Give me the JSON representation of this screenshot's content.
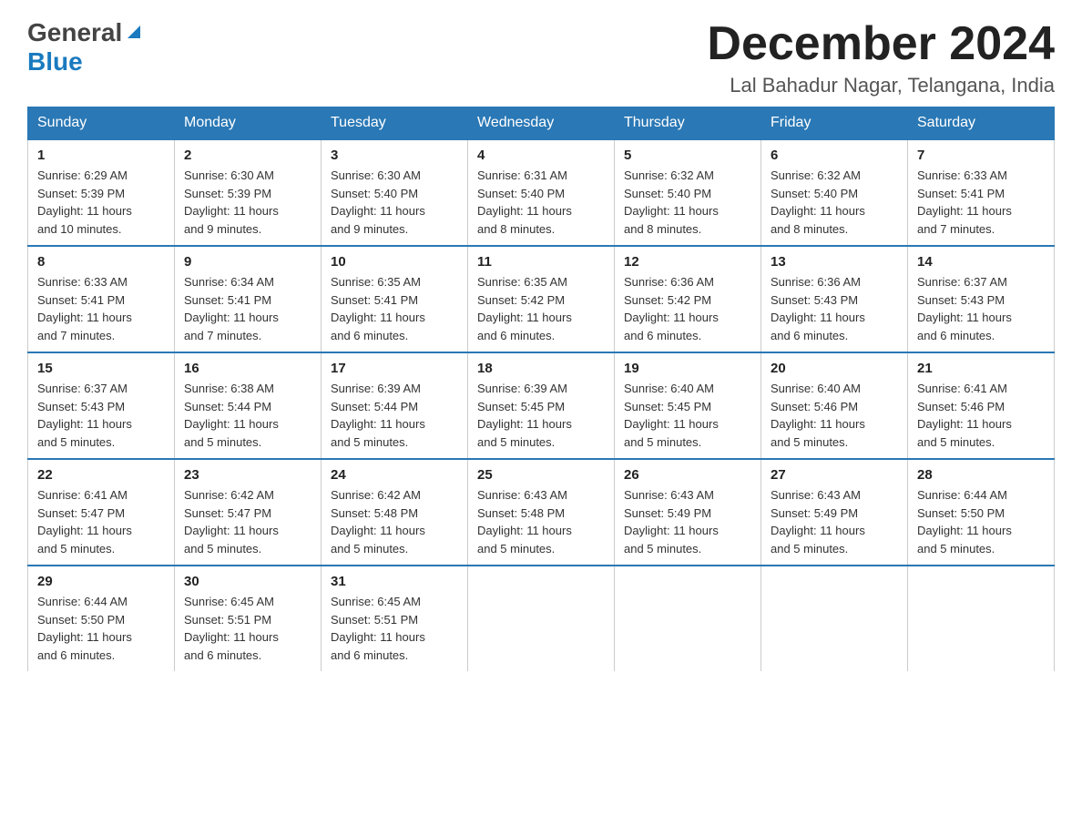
{
  "header": {
    "logo_general": "General",
    "logo_blue": "Blue",
    "month_title": "December 2024",
    "location": "Lal Bahadur Nagar, Telangana, India"
  },
  "days_of_week": [
    "Sunday",
    "Monday",
    "Tuesday",
    "Wednesday",
    "Thursday",
    "Friday",
    "Saturday"
  ],
  "weeks": [
    [
      {
        "day": "1",
        "sunrise": "6:29 AM",
        "sunset": "5:39 PM",
        "daylight": "11 hours and 10 minutes."
      },
      {
        "day": "2",
        "sunrise": "6:30 AM",
        "sunset": "5:39 PM",
        "daylight": "11 hours and 9 minutes."
      },
      {
        "day": "3",
        "sunrise": "6:30 AM",
        "sunset": "5:40 PM",
        "daylight": "11 hours and 9 minutes."
      },
      {
        "day": "4",
        "sunrise": "6:31 AM",
        "sunset": "5:40 PM",
        "daylight": "11 hours and 8 minutes."
      },
      {
        "day": "5",
        "sunrise": "6:32 AM",
        "sunset": "5:40 PM",
        "daylight": "11 hours and 8 minutes."
      },
      {
        "day": "6",
        "sunrise": "6:32 AM",
        "sunset": "5:40 PM",
        "daylight": "11 hours and 8 minutes."
      },
      {
        "day": "7",
        "sunrise": "6:33 AM",
        "sunset": "5:41 PM",
        "daylight": "11 hours and 7 minutes."
      }
    ],
    [
      {
        "day": "8",
        "sunrise": "6:33 AM",
        "sunset": "5:41 PM",
        "daylight": "11 hours and 7 minutes."
      },
      {
        "day": "9",
        "sunrise": "6:34 AM",
        "sunset": "5:41 PM",
        "daylight": "11 hours and 7 minutes."
      },
      {
        "day": "10",
        "sunrise": "6:35 AM",
        "sunset": "5:41 PM",
        "daylight": "11 hours and 6 minutes."
      },
      {
        "day": "11",
        "sunrise": "6:35 AM",
        "sunset": "5:42 PM",
        "daylight": "11 hours and 6 minutes."
      },
      {
        "day": "12",
        "sunrise": "6:36 AM",
        "sunset": "5:42 PM",
        "daylight": "11 hours and 6 minutes."
      },
      {
        "day": "13",
        "sunrise": "6:36 AM",
        "sunset": "5:43 PM",
        "daylight": "11 hours and 6 minutes."
      },
      {
        "day": "14",
        "sunrise": "6:37 AM",
        "sunset": "5:43 PM",
        "daylight": "11 hours and 6 minutes."
      }
    ],
    [
      {
        "day": "15",
        "sunrise": "6:37 AM",
        "sunset": "5:43 PM",
        "daylight": "11 hours and 5 minutes."
      },
      {
        "day": "16",
        "sunrise": "6:38 AM",
        "sunset": "5:44 PM",
        "daylight": "11 hours and 5 minutes."
      },
      {
        "day": "17",
        "sunrise": "6:39 AM",
        "sunset": "5:44 PM",
        "daylight": "11 hours and 5 minutes."
      },
      {
        "day": "18",
        "sunrise": "6:39 AM",
        "sunset": "5:45 PM",
        "daylight": "11 hours and 5 minutes."
      },
      {
        "day": "19",
        "sunrise": "6:40 AM",
        "sunset": "5:45 PM",
        "daylight": "11 hours and 5 minutes."
      },
      {
        "day": "20",
        "sunrise": "6:40 AM",
        "sunset": "5:46 PM",
        "daylight": "11 hours and 5 minutes."
      },
      {
        "day": "21",
        "sunrise": "6:41 AM",
        "sunset": "5:46 PM",
        "daylight": "11 hours and 5 minutes."
      }
    ],
    [
      {
        "day": "22",
        "sunrise": "6:41 AM",
        "sunset": "5:47 PM",
        "daylight": "11 hours and 5 minutes."
      },
      {
        "day": "23",
        "sunrise": "6:42 AM",
        "sunset": "5:47 PM",
        "daylight": "11 hours and 5 minutes."
      },
      {
        "day": "24",
        "sunrise": "6:42 AM",
        "sunset": "5:48 PM",
        "daylight": "11 hours and 5 minutes."
      },
      {
        "day": "25",
        "sunrise": "6:43 AM",
        "sunset": "5:48 PM",
        "daylight": "11 hours and 5 minutes."
      },
      {
        "day": "26",
        "sunrise": "6:43 AM",
        "sunset": "5:49 PM",
        "daylight": "11 hours and 5 minutes."
      },
      {
        "day": "27",
        "sunrise": "6:43 AM",
        "sunset": "5:49 PM",
        "daylight": "11 hours and 5 minutes."
      },
      {
        "day": "28",
        "sunrise": "6:44 AM",
        "sunset": "5:50 PM",
        "daylight": "11 hours and 5 minutes."
      }
    ],
    [
      {
        "day": "29",
        "sunrise": "6:44 AM",
        "sunset": "5:50 PM",
        "daylight": "11 hours and 6 minutes."
      },
      {
        "day": "30",
        "sunrise": "6:45 AM",
        "sunset": "5:51 PM",
        "daylight": "11 hours and 6 minutes."
      },
      {
        "day": "31",
        "sunrise": "6:45 AM",
        "sunset": "5:51 PM",
        "daylight": "11 hours and 6 minutes."
      },
      null,
      null,
      null,
      null
    ]
  ],
  "labels": {
    "sunrise": "Sunrise:",
    "sunset": "Sunset:",
    "daylight": "Daylight:"
  }
}
